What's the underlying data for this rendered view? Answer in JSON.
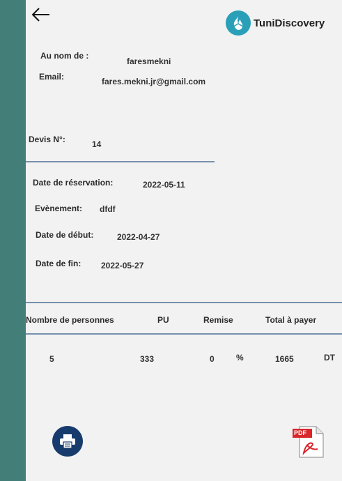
{
  "brand": {
    "name": "TuniDiscovery"
  },
  "client": {
    "name_label": "Au nom de :",
    "name_value": "faresmekni",
    "email_label": "Email:",
    "email_value": "fares.mekni.jr@gmail.com"
  },
  "quote": {
    "number_label": "Devis N°:",
    "number_value": "14"
  },
  "reservation": {
    "date_label": "Date de réservation:",
    "date_value": "2022-05-11",
    "event_label": "Evènement:",
    "event_value": "dfdf",
    "start_label": "Date de début:",
    "start_value": "2022-04-27",
    "end_label": "Date de fin:",
    "end_value": "2022-05-27"
  },
  "table": {
    "headers": [
      "Nombre de personnes",
      "PU",
      "Remise",
      "Total à payer"
    ],
    "row": {
      "persons": "5",
      "pu": "333",
      "remise": "0",
      "remise_unit": "%",
      "total": "1665",
      "currency": "DT"
    }
  },
  "actions": {
    "print_icon": "printer-icon",
    "pdf_icon": "pdf-file-icon",
    "pdf_badge": "PDF"
  },
  "colors": {
    "sidebar": "#437e79",
    "divider": "#7790ad",
    "print_button": "#173b6c",
    "pdf_red": "#d9262b"
  }
}
